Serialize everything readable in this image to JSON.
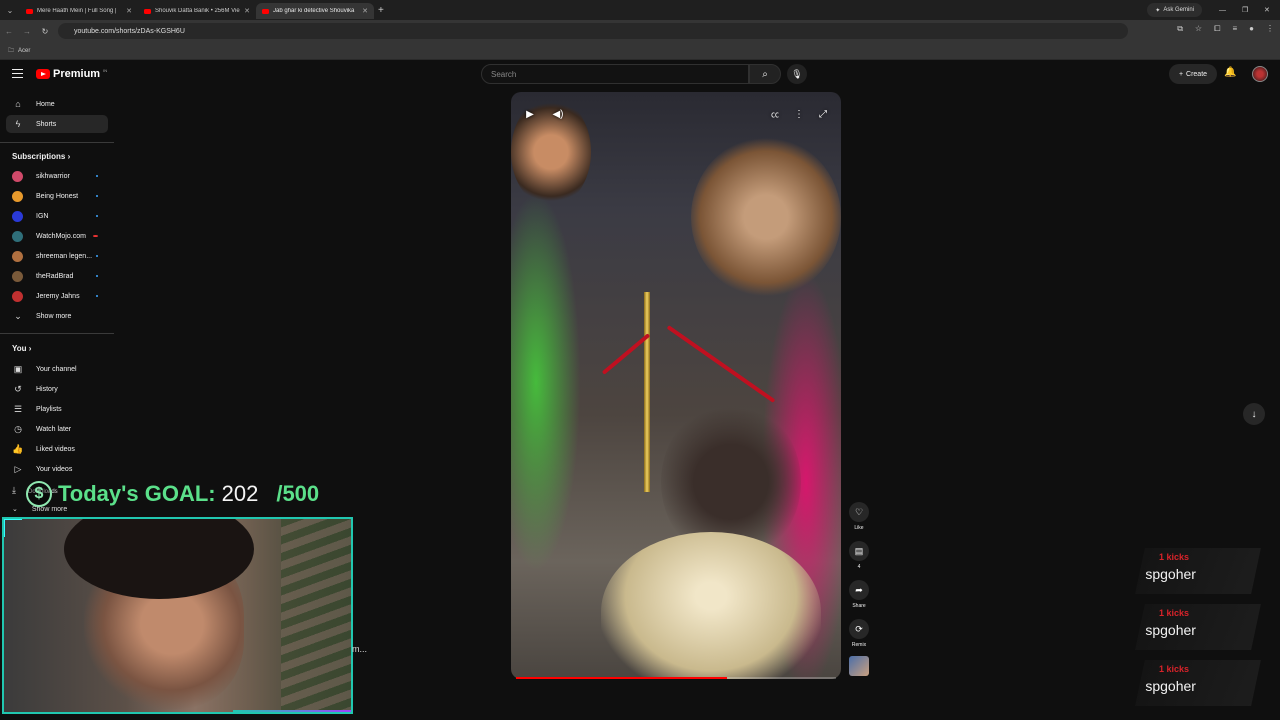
{
  "browser": {
    "tabs": [
      {
        "title": "Mere Haath Mein | Full Song | ",
        "active": false
      },
      {
        "title": "Shouvik Datta Banik • 256M Vie",
        "active": false
      },
      {
        "title": "Jab ghar ki detective Shouvika",
        "active": true
      }
    ],
    "ask_gemini": "Ask Gemini",
    "url": "youtube.com/shorts/zDAs-KGSH6U",
    "bookmark_folder": "Acer"
  },
  "header": {
    "logo_text": "Premium",
    "logo_sup": "IN",
    "search_placeholder": "Search",
    "create_label": "Create"
  },
  "sidebar": {
    "nav": [
      {
        "label": "Home",
        "icon": "home-icon"
      },
      {
        "label": "Shorts",
        "icon": "shorts-icon",
        "active": true
      }
    ],
    "subscriptions_heading": "Subscriptions",
    "channels": [
      {
        "label": "sikhwarrior",
        "color": "#d04a6a"
      },
      {
        "label": "Being Honest",
        "color": "#e89a2c"
      },
      {
        "label": "IGN",
        "color": "#2a3ad8"
      },
      {
        "label": "WatchMojo.com",
        "color": "#2f6f7a"
      },
      {
        "label": "shreeman legen...",
        "color": "#b07040"
      },
      {
        "label": "theRadBrad",
        "color": "#7a5a3a"
      },
      {
        "label": "Jeremy Jahns",
        "color": "#c03030"
      }
    ],
    "show_more_1": "Show more",
    "you_heading": "You",
    "you_items": [
      {
        "label": "Your channel",
        "icon": "channel-icon"
      },
      {
        "label": "History",
        "icon": "history-icon"
      },
      {
        "label": "Playlists",
        "icon": "playlists-icon"
      },
      {
        "label": "Watch later",
        "icon": "clock-icon"
      },
      {
        "label": "Liked videos",
        "icon": "like-icon"
      },
      {
        "label": "Your videos",
        "icon": "video-icon"
      }
    ],
    "downloads_label": "Downloads",
    "show_more_2": "Show more"
  },
  "actions": {
    "like_label": "Like",
    "comments_count": "4",
    "share_label": "Share",
    "remix_label": "Remix"
  },
  "video": {
    "progress": 0.66
  },
  "overlay": {
    "goal_label": "Today's GOAL:",
    "goal_current": "202",
    "goal_total": "/500",
    "webcam_trailing": "m...",
    "kicks": [
      {
        "count": "1 kicks",
        "user": "spgoher"
      },
      {
        "count": "1 kicks",
        "user": "spgoher"
      },
      {
        "count": "1 kicks",
        "user": "spgoher"
      }
    ]
  }
}
